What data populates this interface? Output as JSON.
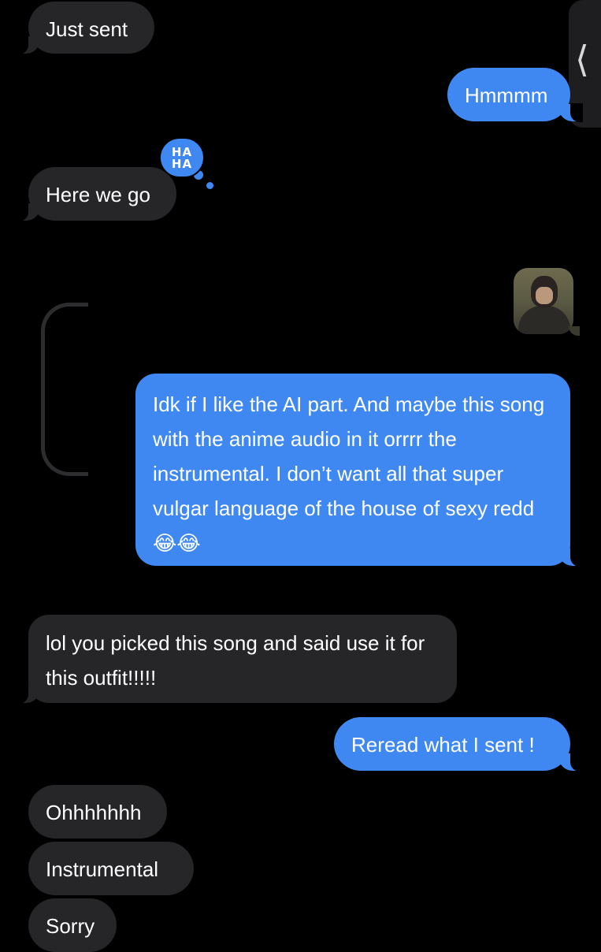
{
  "conversation": {
    "messages": [
      {
        "id": "m1",
        "direction": "incoming",
        "text": "Just sent"
      },
      {
        "id": "m2",
        "direction": "outgoing",
        "text": "Hmmmm"
      },
      {
        "id": "m3",
        "direction": "incoming",
        "text": "Here we go",
        "tapback": "HA HA"
      },
      {
        "id": "m4",
        "direction": "outgoing",
        "type": "sticker",
        "icon": "anime-character-sticker"
      },
      {
        "id": "m5",
        "direction": "outgoing",
        "text": "Idk if I like the AI part. And maybe this song with the anime audio in it orrrr the instrumental. I don’t want all that super vulgar language of the house of sexy redd 😂😂"
      },
      {
        "id": "m6",
        "direction": "incoming",
        "text": "lol you picked this song and said use it for this outfit!!!!!"
      },
      {
        "id": "m7",
        "direction": "outgoing",
        "text": "Reread what I sent !"
      },
      {
        "id": "m8",
        "direction": "incoming",
        "text": "Ohhhhhhh"
      },
      {
        "id": "m9",
        "direction": "incoming",
        "text": "Instrumental"
      },
      {
        "id": "m10",
        "direction": "incoming",
        "text": "Sorry"
      }
    ],
    "tapback_label": {
      "line1": "HA",
      "line2": "HA"
    },
    "side_tab_icon": "chevron-left-icon",
    "colors": {
      "background": "#000000",
      "incoming_bubble": "#262629",
      "outgoing_bubble": "#3f88f2",
      "text": "#ffffff"
    }
  }
}
